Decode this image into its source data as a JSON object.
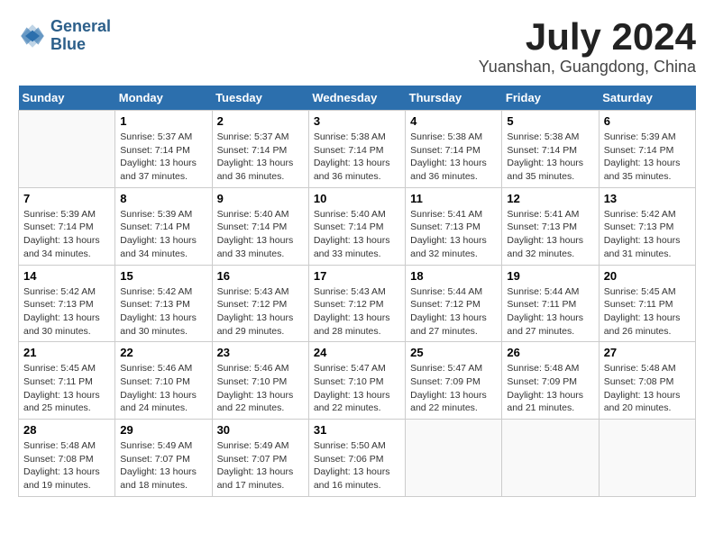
{
  "header": {
    "logo_line1": "General",
    "logo_line2": "Blue",
    "month_year": "July 2024",
    "location": "Yuanshan, Guangdong, China"
  },
  "weekdays": [
    "Sunday",
    "Monday",
    "Tuesday",
    "Wednesday",
    "Thursday",
    "Friday",
    "Saturday"
  ],
  "weeks": [
    [
      {
        "day": "",
        "sunrise": "",
        "sunset": "",
        "daylight": ""
      },
      {
        "day": "1",
        "sunrise": "Sunrise: 5:37 AM",
        "sunset": "Sunset: 7:14 PM",
        "daylight": "Daylight: 13 hours and 37 minutes."
      },
      {
        "day": "2",
        "sunrise": "Sunrise: 5:37 AM",
        "sunset": "Sunset: 7:14 PM",
        "daylight": "Daylight: 13 hours and 36 minutes."
      },
      {
        "day": "3",
        "sunrise": "Sunrise: 5:38 AM",
        "sunset": "Sunset: 7:14 PM",
        "daylight": "Daylight: 13 hours and 36 minutes."
      },
      {
        "day": "4",
        "sunrise": "Sunrise: 5:38 AM",
        "sunset": "Sunset: 7:14 PM",
        "daylight": "Daylight: 13 hours and 36 minutes."
      },
      {
        "day": "5",
        "sunrise": "Sunrise: 5:38 AM",
        "sunset": "Sunset: 7:14 PM",
        "daylight": "Daylight: 13 hours and 35 minutes."
      },
      {
        "day": "6",
        "sunrise": "Sunrise: 5:39 AM",
        "sunset": "Sunset: 7:14 PM",
        "daylight": "Daylight: 13 hours and 35 minutes."
      }
    ],
    [
      {
        "day": "7",
        "sunrise": "Sunrise: 5:39 AM",
        "sunset": "Sunset: 7:14 PM",
        "daylight": "Daylight: 13 hours and 34 minutes."
      },
      {
        "day": "8",
        "sunrise": "Sunrise: 5:39 AM",
        "sunset": "Sunset: 7:14 PM",
        "daylight": "Daylight: 13 hours and 34 minutes."
      },
      {
        "day": "9",
        "sunrise": "Sunrise: 5:40 AM",
        "sunset": "Sunset: 7:14 PM",
        "daylight": "Daylight: 13 hours and 33 minutes."
      },
      {
        "day": "10",
        "sunrise": "Sunrise: 5:40 AM",
        "sunset": "Sunset: 7:14 PM",
        "daylight": "Daylight: 13 hours and 33 minutes."
      },
      {
        "day": "11",
        "sunrise": "Sunrise: 5:41 AM",
        "sunset": "Sunset: 7:13 PM",
        "daylight": "Daylight: 13 hours and 32 minutes."
      },
      {
        "day": "12",
        "sunrise": "Sunrise: 5:41 AM",
        "sunset": "Sunset: 7:13 PM",
        "daylight": "Daylight: 13 hours and 32 minutes."
      },
      {
        "day": "13",
        "sunrise": "Sunrise: 5:42 AM",
        "sunset": "Sunset: 7:13 PM",
        "daylight": "Daylight: 13 hours and 31 minutes."
      }
    ],
    [
      {
        "day": "14",
        "sunrise": "Sunrise: 5:42 AM",
        "sunset": "Sunset: 7:13 PM",
        "daylight": "Daylight: 13 hours and 30 minutes."
      },
      {
        "day": "15",
        "sunrise": "Sunrise: 5:42 AM",
        "sunset": "Sunset: 7:13 PM",
        "daylight": "Daylight: 13 hours and 30 minutes."
      },
      {
        "day": "16",
        "sunrise": "Sunrise: 5:43 AM",
        "sunset": "Sunset: 7:12 PM",
        "daylight": "Daylight: 13 hours and 29 minutes."
      },
      {
        "day": "17",
        "sunrise": "Sunrise: 5:43 AM",
        "sunset": "Sunset: 7:12 PM",
        "daylight": "Daylight: 13 hours and 28 minutes."
      },
      {
        "day": "18",
        "sunrise": "Sunrise: 5:44 AM",
        "sunset": "Sunset: 7:12 PM",
        "daylight": "Daylight: 13 hours and 27 minutes."
      },
      {
        "day": "19",
        "sunrise": "Sunrise: 5:44 AM",
        "sunset": "Sunset: 7:11 PM",
        "daylight": "Daylight: 13 hours and 27 minutes."
      },
      {
        "day": "20",
        "sunrise": "Sunrise: 5:45 AM",
        "sunset": "Sunset: 7:11 PM",
        "daylight": "Daylight: 13 hours and 26 minutes."
      }
    ],
    [
      {
        "day": "21",
        "sunrise": "Sunrise: 5:45 AM",
        "sunset": "Sunset: 7:11 PM",
        "daylight": "Daylight: 13 hours and 25 minutes."
      },
      {
        "day": "22",
        "sunrise": "Sunrise: 5:46 AM",
        "sunset": "Sunset: 7:10 PM",
        "daylight": "Daylight: 13 hours and 24 minutes."
      },
      {
        "day": "23",
        "sunrise": "Sunrise: 5:46 AM",
        "sunset": "Sunset: 7:10 PM",
        "daylight": "Daylight: 13 hours and 22 minutes."
      },
      {
        "day": "24",
        "sunrise": "Sunrise: 5:47 AM",
        "sunset": "Sunset: 7:10 PM",
        "daylight": "Daylight: 13 hours and 22 minutes."
      },
      {
        "day": "25",
        "sunrise": "Sunrise: 5:47 AM",
        "sunset": "Sunset: 7:09 PM",
        "daylight": "Daylight: 13 hours and 22 minutes."
      },
      {
        "day": "26",
        "sunrise": "Sunrise: 5:48 AM",
        "sunset": "Sunset: 7:09 PM",
        "daylight": "Daylight: 13 hours and 21 minutes."
      },
      {
        "day": "27",
        "sunrise": "Sunrise: 5:48 AM",
        "sunset": "Sunset: 7:08 PM",
        "daylight": "Daylight: 13 hours and 20 minutes."
      }
    ],
    [
      {
        "day": "28",
        "sunrise": "Sunrise: 5:48 AM",
        "sunset": "Sunset: 7:08 PM",
        "daylight": "Daylight: 13 hours and 19 minutes."
      },
      {
        "day": "29",
        "sunrise": "Sunrise: 5:49 AM",
        "sunset": "Sunset: 7:07 PM",
        "daylight": "Daylight: 13 hours and 18 minutes."
      },
      {
        "day": "30",
        "sunrise": "Sunrise: 5:49 AM",
        "sunset": "Sunset: 7:07 PM",
        "daylight": "Daylight: 13 hours and 17 minutes."
      },
      {
        "day": "31",
        "sunrise": "Sunrise: 5:50 AM",
        "sunset": "Sunset: 7:06 PM",
        "daylight": "Daylight: 13 hours and 16 minutes."
      },
      {
        "day": "",
        "sunrise": "",
        "sunset": "",
        "daylight": ""
      },
      {
        "day": "",
        "sunrise": "",
        "sunset": "",
        "daylight": ""
      },
      {
        "day": "",
        "sunrise": "",
        "sunset": "",
        "daylight": ""
      }
    ]
  ]
}
